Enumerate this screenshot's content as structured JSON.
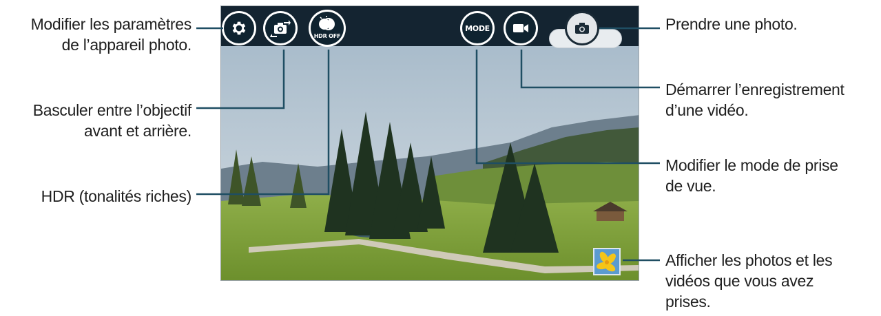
{
  "callouts": {
    "settings": [
      "Modifier les paramètres",
      "de l’appareil photo."
    ],
    "switch_camera": [
      "Basculer entre l’objectif",
      "avant et arrière."
    ],
    "hdr": [
      "HDR (tonalités riches)"
    ],
    "take_photo": [
      "Prendre une photo."
    ],
    "record_video": [
      "Démarrer l’enregistrement",
      "d’une vidéo."
    ],
    "shooting_mode": [
      "Modifier le mode de prise",
      "de vue."
    ],
    "gallery": [
      "Afficher les photos et les",
      "vidéos que vous avez",
      "prises."
    ]
  },
  "camera": {
    "mode_label": "MODE",
    "hdr_label": "HDR OFF"
  },
  "icons": {
    "settings": "gear-icon",
    "switch_camera": "camera-switch-icon",
    "hdr": "hdr-icon",
    "mode": "mode-icon",
    "video": "video-camera-icon",
    "shutter": "camera-icon",
    "gallery": "gallery-thumbnail-icon"
  },
  "colors": {
    "bar": "#142431",
    "button": "#0f2330",
    "line": "#1f4e63"
  }
}
